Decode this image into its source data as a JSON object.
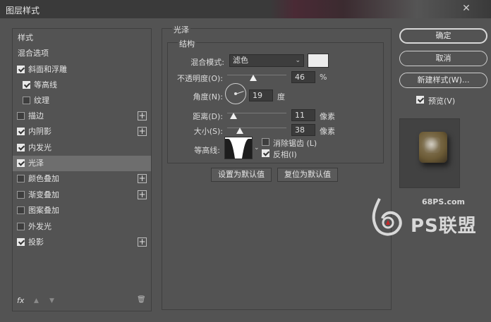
{
  "window": {
    "title": "图层样式",
    "close_glyph": "✕"
  },
  "sidebar": {
    "header_styles": "样式",
    "header_blend": "混合选项",
    "items": [
      {
        "label": "斜面和浮雕",
        "checked": true
      },
      {
        "label": "等高线",
        "checked": true
      },
      {
        "label": "纹理",
        "checked": false
      },
      {
        "label": "描边",
        "checked": false
      },
      {
        "label": "内阴影",
        "checked": true
      },
      {
        "label": "内发光",
        "checked": true
      },
      {
        "label": "光泽",
        "checked": true
      },
      {
        "label": "颜色叠加",
        "checked": false
      },
      {
        "label": "渐变叠加",
        "checked": false
      },
      {
        "label": "图案叠加",
        "checked": false
      },
      {
        "label": "外发光",
        "checked": false
      },
      {
        "label": "投影",
        "checked": true
      }
    ],
    "fx_label": "fx",
    "up_icon": "▲",
    "down_icon": "▼",
    "trash_icon": "🗑"
  },
  "satin": {
    "section_title": "光泽",
    "structure_title": "结构",
    "blend_mode_label": "混合模式:",
    "blend_mode_value": "滤色",
    "blend_color": "#ececec",
    "opacity_label": "不透明度(O):",
    "opacity_value": "46",
    "opacity_unit": "%",
    "angle_label": "角度(N):",
    "angle_value": "19",
    "angle_unit": "度",
    "distance_label": "距离(D):",
    "distance_value": "11",
    "distance_unit": "像素",
    "size_label": "大小(S):",
    "size_value": "38",
    "size_unit": "像素",
    "contour_label": "等高线:",
    "antialias_label": "消除锯齿 (L)",
    "antialias_checked": false,
    "invert_label": "反相(I)",
    "invert_checked": true,
    "make_default": "设置为默认值",
    "reset_default": "复位为默认值"
  },
  "actions": {
    "ok": "确定",
    "cancel": "取消",
    "new_style": "新建样式(W)...",
    "preview_label": "预览(V)",
    "preview_checked": true
  },
  "watermark": {
    "url": "68PS.com",
    "text": "PS联盟"
  }
}
